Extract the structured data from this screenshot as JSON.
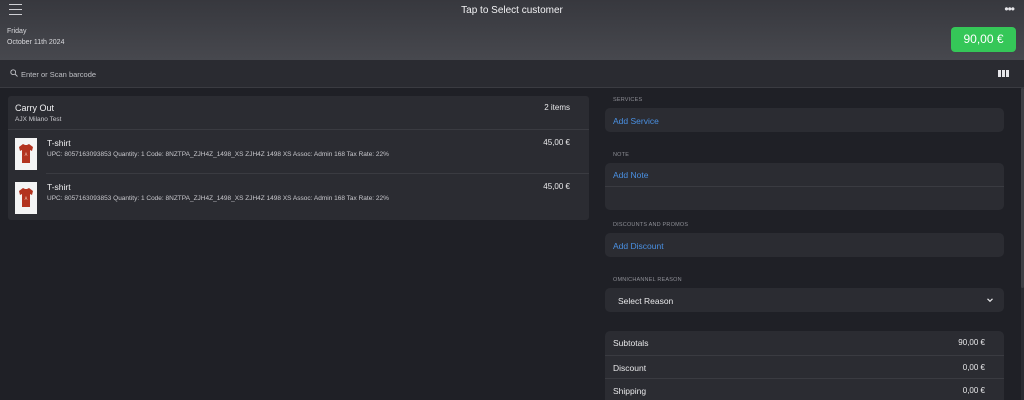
{
  "header": {
    "title": "Tap to Select customer",
    "day": "Friday",
    "date": "October 11th 2024",
    "total": "90,00 €"
  },
  "search": {
    "placeholder": "Enter or Scan barcode"
  },
  "order": {
    "type": "Carry Out",
    "store": "AJX Milano Test",
    "item_count": "2 items",
    "items": [
      {
        "name": "T-shirt",
        "description": "UPC: 8057163093853 Quantity: 1 Code: 8NZTPA_ZJH4Z_1498_XS ZJH4Z 1498 XS Assoc: Admin 168 Tax Rate: 22%",
        "price": "45,00 €"
      },
      {
        "name": "T-shirt",
        "description": "UPC: 8057163093853 Quantity: 1 Code: 8NZTPA_ZJH4Z_1498_XS ZJH4Z 1498 XS Assoc: Admin 168 Tax Rate: 22%",
        "price": "45,00 €"
      }
    ]
  },
  "services": {
    "label": "SERVICES",
    "action": "Add Service"
  },
  "note": {
    "label": "NOTE",
    "action": "Add Note",
    "value": ""
  },
  "discounts": {
    "label": "DISCOUNTS AND PROMOS",
    "action": "Add Discount"
  },
  "omnichannel": {
    "label": "OMNICHANNEL REASON",
    "selected": "Select Reason"
  },
  "summary": [
    {
      "label": "Subtotals",
      "value": "90,00 €"
    },
    {
      "label": "Discount",
      "value": "0,00 €"
    },
    {
      "label": "Shipping",
      "value": "0,00 €"
    }
  ],
  "colors": {
    "accent_green": "#35c758",
    "link_blue": "#4a90e2",
    "background": "#1f2026",
    "panel": "#2b2c32"
  },
  "icons": {
    "menu": "hamburger-menu-icon",
    "more": "more-dots-icon",
    "search": "search-icon",
    "barcode": "barcode-scan-icon",
    "chevron": "chevron-down-icon",
    "product": "red-tshirt-thumbnail"
  }
}
